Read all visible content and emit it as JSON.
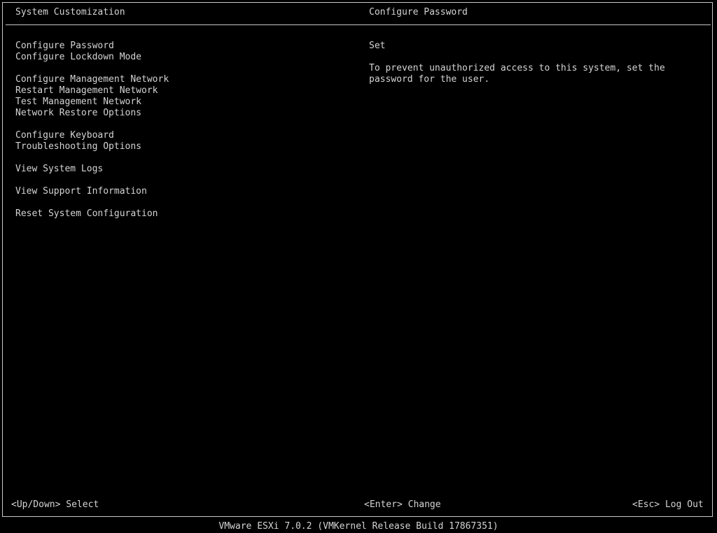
{
  "header": {
    "left_title": "System Customization",
    "right_title": "Configure Password"
  },
  "menu": {
    "groups": [
      [
        "Configure Password",
        "Configure Lockdown Mode"
      ],
      [
        "Configure Management Network",
        "Restart Management Network",
        "Test Management Network",
        "Network Restore Options"
      ],
      [
        "Configure Keyboard",
        "Troubleshooting Options"
      ],
      [
        "View System Logs"
      ],
      [
        "View Support Information"
      ],
      [
        "Reset System Configuration"
      ]
    ]
  },
  "detail": {
    "status": "Set",
    "description": "To prevent unauthorized access to this system, set the password for the user."
  },
  "footer": {
    "hint_left": "<Up/Down> Select",
    "hint_center": "<Enter> Change",
    "hint_right": "<Esc> Log Out",
    "version": "VMware ESXi 7.0.2 (VMKernel Release Build 17867351)"
  }
}
